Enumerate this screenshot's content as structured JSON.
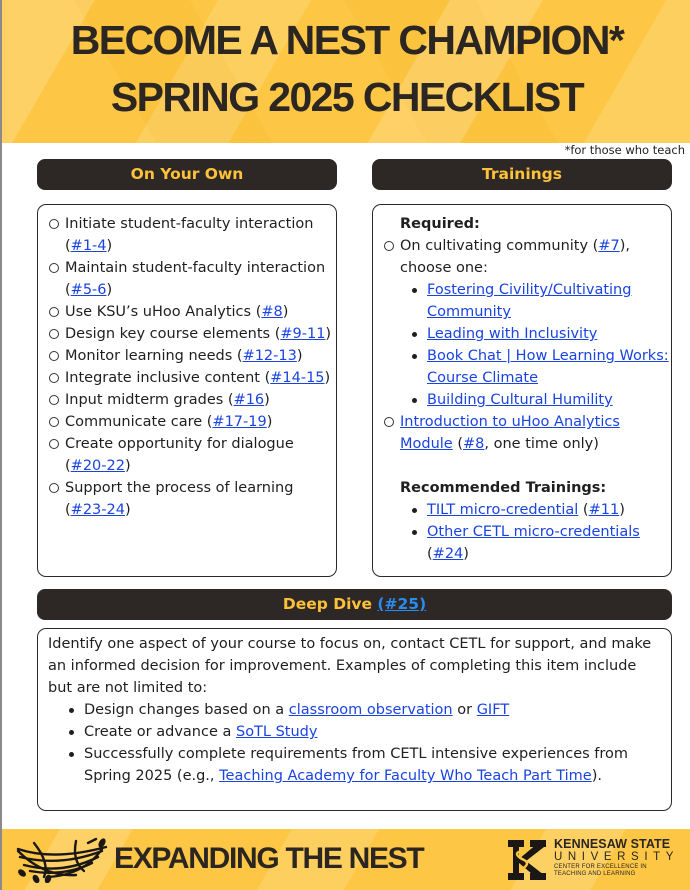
{
  "header": {
    "title_line1": "BECOME A NEST CHAMPION*",
    "title_line2": "SPRING 2025 CHECKLIST",
    "footnote": "*for those who teach"
  },
  "on_your_own": {
    "heading": "On Your Own",
    "items": [
      {
        "text": "Initiate student-faculty interaction (",
        "link": "#1-4",
        "suffix": ")"
      },
      {
        "text": "Maintain student-faculty interaction (",
        "link": "#5-6",
        "suffix": ")"
      },
      {
        "text": "Use KSU’s uHoo Analytics (",
        "link": "#8",
        "suffix": ")"
      },
      {
        "text": "Design key course elements (",
        "link": "#9-11",
        "suffix": ")"
      },
      {
        "text": "Monitor learning needs (",
        "link": "#12-13",
        "suffix": ")"
      },
      {
        "text": "Integrate inclusive content (",
        "link": "#14-15",
        "suffix": ")"
      },
      {
        "text": "Input midterm grades (",
        "link": "#16",
        "suffix": ")"
      },
      {
        "text": "Communicate care (",
        "link": "#17-19",
        "suffix": ")"
      },
      {
        "text": "Create opportunity for dialogue (",
        "link": "#20-22",
        "suffix": ")"
      },
      {
        "text": "Support the process of learning (",
        "link": "#23-24",
        "suffix": ")"
      }
    ]
  },
  "trainings": {
    "heading": "Trainings",
    "required_label": "Required:",
    "community_item": {
      "text": "On cultivating community (",
      "link": "#7",
      "suffix": "), choose one:"
    },
    "community_options": [
      "Fostering Civility/Cultivating Community",
      "Leading with Inclusivity",
      "Book Chat | How Learning Works: Course Climate",
      "Building Cultural Humility"
    ],
    "uhoo_item": {
      "link_text": "Introduction to uHoo Analytics Module",
      "prefix": " (",
      "ref": "#8",
      "suffix": ", one time only)"
    },
    "recommended_label": "Recommended Trainings:",
    "recommended": [
      {
        "link_text": "TILT micro-credential",
        "prefix": " (",
        "ref": "#11",
        "suffix": ")"
      },
      {
        "link_text": "Other CETL micro-credentials",
        "prefix": " (",
        "ref": "#24",
        "suffix": ")"
      }
    ]
  },
  "deep_dive": {
    "heading": "Deep Dive",
    "heading_link": "(#25)",
    "intro": "Identify one aspect of your course to focus on, contact CETL for support, and make an informed decision for improvement. Examples of completing this item include but are not limited to:",
    "examples": {
      "ex1_text": "Design changes based on a ",
      "ex1_link1": "classroom observation",
      "ex1_mid": " or ",
      "ex1_link2": "GIFT",
      "ex2_text": "Create or advance a ",
      "ex2_link": "SoTL Study",
      "ex3_text": "Successfully complete requirements from CETL intensive experiences from Spring 2025 (e.g., ",
      "ex3_link": "Teaching Academy for Faculty Who Teach Part Time",
      "ex3_suffix": ")."
    }
  },
  "footer": {
    "title": "EXPANDING THE NEST",
    "ksu_line1": "KENNESAW STATE",
    "ksu_line2": "UNIVERSITY",
    "ksu_line3a": "CENTER FOR EXCELLENCE IN",
    "ksu_line3b": "TEACHING AND LEARNING"
  },
  "colors": {
    "brand_gold": "#fdc745",
    "pill_dark": "#2d2825",
    "pill_text": "#fdc13a",
    "link_blue": "#1a44e0"
  }
}
